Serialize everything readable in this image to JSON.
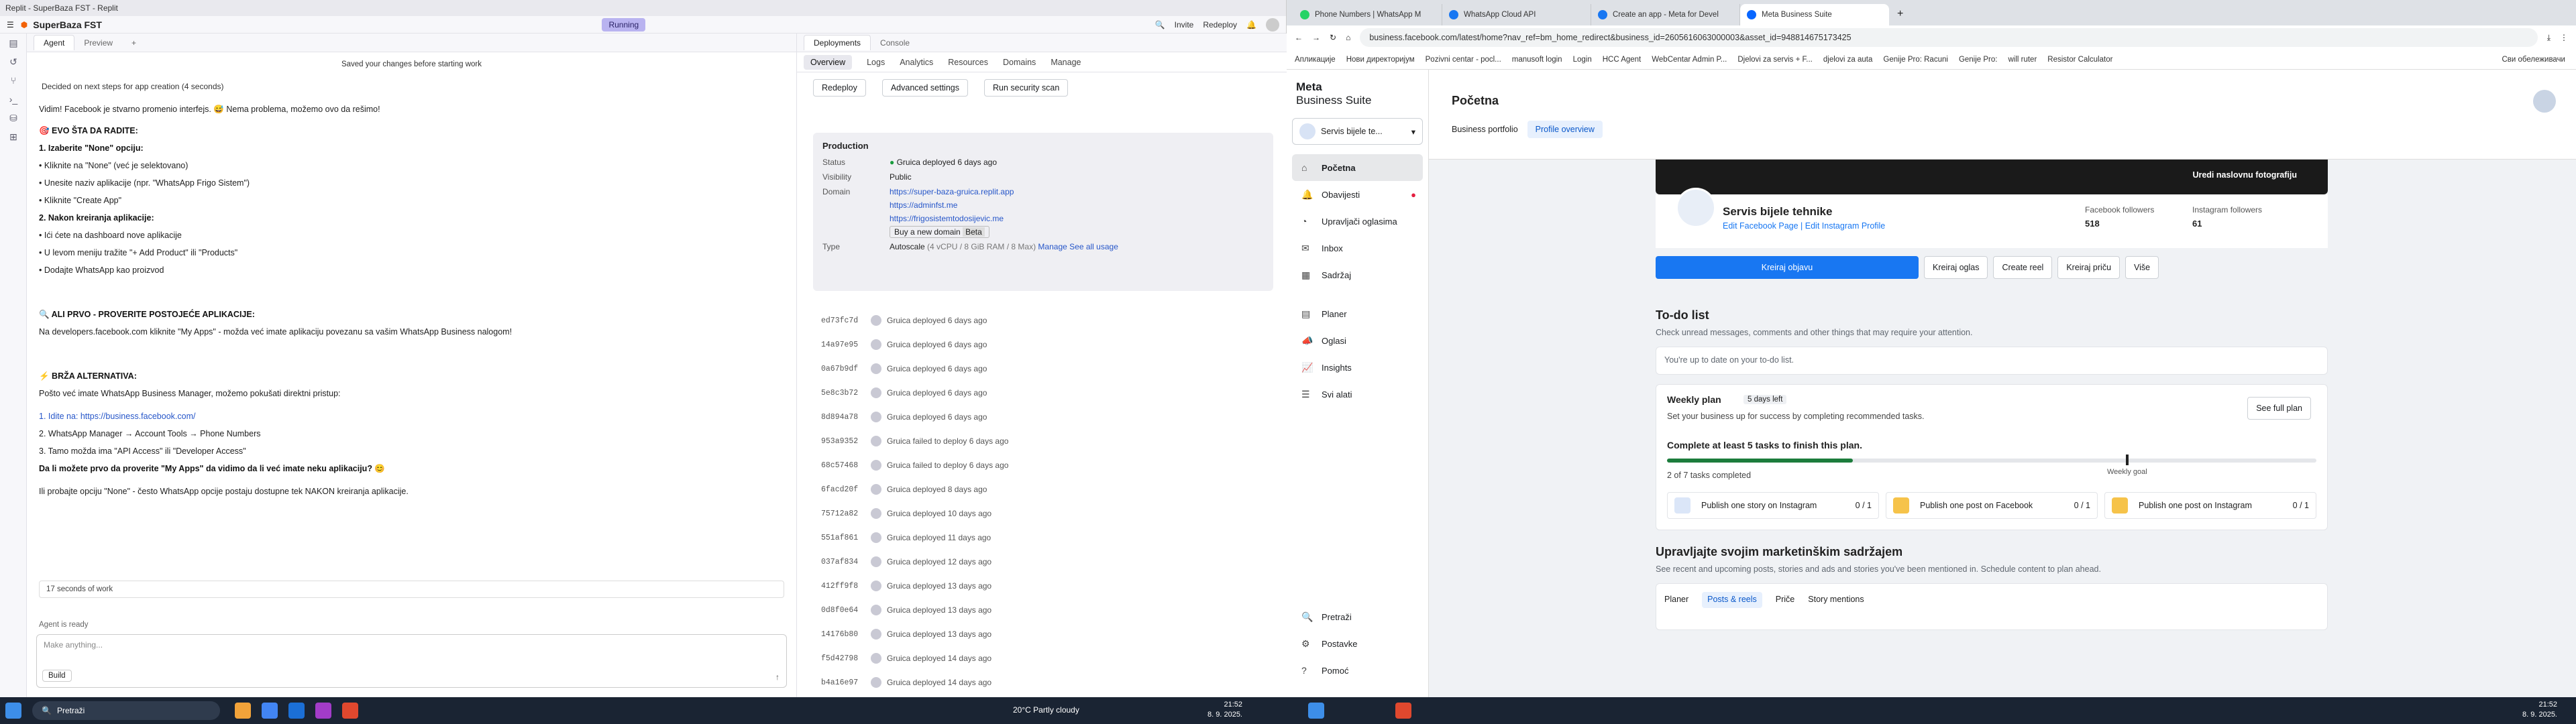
{
  "replit": {
    "window_title": "Replit - SuperBaza FST - Replit",
    "app_name": "SuperBaza FST",
    "status": "Running",
    "invite": "Invite",
    "redeploy": "Redeploy",
    "agent_tab": "Agent",
    "preview_tab": "Preview",
    "saved_msg": "Saved your changes before starting work",
    "decided": "Decided on next steps for app creation (4 seconds)",
    "chat": [
      "Vidim! Facebook je stvarno promenio interfejs. 😅 Nema problema, možemo ovo da rešimo!",
      "🎯 EVO ŠTA DA RADITE:",
      "1. Izaberite \"None\" opciju:",
      "• Kliknite na \"None\" (već je selektovano)",
      "• Unesite naziv aplikacije (npr. \"WhatsApp Frigo Sistem\")",
      "• Kliknite \"Create App\"",
      "2. Nakon kreiranja aplikacije:",
      "• Ići ćete na dashboard nove aplikacije",
      "• U levom meniju tražite \"+ Add Product\" ili \"Products\"",
      "• Dodajte WhatsApp kao proizvod",
      "🔍 ALI PRVO - PROVERITE POSTOJEĆE APLIKACIJE:",
      "Na developers.facebook.com kliknite \"My Apps\" - možda već imate aplikaciju povezanu sa vašim WhatsApp Business nalogom!",
      "⚡ BRŽA ALTERNATIVA:",
      "Pošto već imate WhatsApp Business Manager, možemo pokušati direktni pristup:",
      "1. Idite na: https://business.facebook.com/",
      "2. WhatsApp Manager → Account Tools → Phone Numbers",
      "3. Tamo možda ima \"API Access\" ili \"Developer Access\"",
      "Da li možete prvo da proverite \"My Apps\" da vidimo da li već imate neku aplikaciju? 😊",
      "Ili probajte opciju \"None\" - često WhatsApp opcije postaju dostupne tek NAKON kreiranja aplikacije."
    ],
    "worked": "17 seconds of work",
    "agent_ready": "Agent is ready",
    "input_placeholder": "Make anything...",
    "build": "Build",
    "deploy_tabs": [
      "Deployments",
      "Console"
    ],
    "deploy_nav": [
      "Overview",
      "Logs",
      "Analytics",
      "Resources",
      "Domains",
      "Manage"
    ],
    "redeploy2": "Redeploy",
    "adv": "Advanced settings",
    "scan": "Run security scan",
    "production": "Production",
    "status_label": "Status",
    "status_val": "Gruica deployed 6 days ago",
    "vis_label": "Visibility",
    "vis_val": "Public",
    "domain_label": "Domain",
    "domains": [
      "https://super-baza-gruica.replit.app",
      "https://adminfst.me",
      "https://frigosistemtodosijevic.me"
    ],
    "buy_domain": "Buy a new domain",
    "beta": "Beta",
    "type_label": "Type",
    "type_val": "Autoscale",
    "type_spec": "(4 vCPU / 8 GiB RAM / 8 Max)",
    "manage": "Manage",
    "see_usage": "See all usage",
    "deploys": [
      [
        "ed73fc7d",
        "Gruica deployed 6 days ago"
      ],
      [
        "14a97e95",
        "Gruica deployed 6 days ago"
      ],
      [
        "0a67b9df",
        "Gruica deployed 6 days ago"
      ],
      [
        "5e8c3b72",
        "Gruica deployed 6 days ago"
      ],
      [
        "8d894a78",
        "Gruica deployed 6 days ago"
      ],
      [
        "953a9352",
        "Gruica failed to deploy 6 days ago"
      ],
      [
        "68c57468",
        "Gruica failed to deploy 6 days ago"
      ],
      [
        "6facd20f",
        "Gruica deployed 8 days ago"
      ],
      [
        "75712a82",
        "Gruica deployed 10 days ago"
      ],
      [
        "551af861",
        "Gruica deployed 11 days ago"
      ],
      [
        "037af834",
        "Gruica deployed 12 days ago"
      ],
      [
        "412ff9f8",
        "Gruica deployed 13 days ago"
      ],
      [
        "0d8f0e64",
        "Gruica deployed 13 days ago"
      ],
      [
        "14176b80",
        "Gruica deployed 13 days ago"
      ],
      [
        "f5d42798",
        "Gruica deployed 14 days ago"
      ],
      [
        "b4a16e97",
        "Gruica deployed 14 days ago"
      ]
    ]
  },
  "chrome": {
    "tabs": [
      "Phone Numbers | WhatsApp M",
      "WhatsApp Cloud API",
      "Create an app - Meta for Devel",
      "Meta Business Suite"
    ],
    "url": "business.facebook.com/latest/home?nav_ref=bm_home_redirect&business_id=2605616063000003&asset_id=948814675173425",
    "bookmarks": [
      "Апликације",
      "Нови директоријум",
      "Pozivni centar - pocl...",
      "manusoft login",
      "Login",
      "HCC Agent",
      "WebCentar Admin P...",
      "Djelovi za servis + F...",
      "djelovi za auta",
      "Genije Pro: Racuni",
      "Genije Pro:",
      "will ruter",
      "Resistor Calculator",
      "Сви обележивачи"
    ]
  },
  "meta": {
    "logo1": "Meta",
    "logo2": "Business Suite",
    "account": "Servis bijele te...",
    "nav": [
      "Početna",
      "Obavijesti",
      "Upravljači oglasima",
      "Inbox",
      "Sadržaj",
      "Planer",
      "Oglasi",
      "Insights",
      "Svi alati"
    ],
    "nav_bottom": [
      "Pretraži",
      "Postavke",
      "Pomoć"
    ],
    "page_title": "Početna",
    "htabs": [
      "Business portfolio",
      "Profile overview"
    ],
    "cover_btn": "Uredi naslovnu fotografiju",
    "biz_name": "Servis bijele tehnike",
    "edit_links": "Edit Facebook Page | Edit Instagram Profile",
    "fb_label": "Facebook followers",
    "fb_val": "518",
    "ig_label": "Instagram followers",
    "ig_val": "61",
    "actions": [
      "Kreiraj objavu",
      "Kreiraj oglas",
      "Create reel",
      "Kreiraj priču",
      "Više"
    ],
    "todo_title": "To-do list",
    "todo_sub": "Check unread messages, comments and other things that may require your attention.",
    "todo_empty": "You're up to date on your to-do list.",
    "weekly": "Weekly plan",
    "days_left": "5 days left",
    "weekly_sub": "Set your business up for success by completing recommended tasks.",
    "full_plan": "See full plan",
    "complete": "Complete at least 5 tasks to finish this plan.",
    "progress": 0.2857,
    "progress_text": "2 of 7 tasks completed",
    "goal": "Weekly goal",
    "tasks": [
      [
        "Publish one story on Instagram",
        "0 / 1"
      ],
      [
        "Publish one post on Facebook",
        "0 / 1"
      ],
      [
        "Publish one post on Instagram",
        "0 / 1"
      ]
    ],
    "mk_title": "Upravljajte svojim marketinškim sadržajem",
    "mk_sub": "See recent and upcoming posts, stories and ads and stories you've been mentioned in. Schedule content to plan ahead.",
    "mk_tabs": [
      "Planer",
      "Posts & reels",
      "Priče",
      "Story mentions"
    ]
  },
  "taskbar": {
    "search": "Pretraži",
    "weather": "20°C  Partly cloudy",
    "time": "21:52",
    "date": "8. 9. 2025.",
    "time2": "21:52",
    "date2": "8. 9. 2025."
  }
}
